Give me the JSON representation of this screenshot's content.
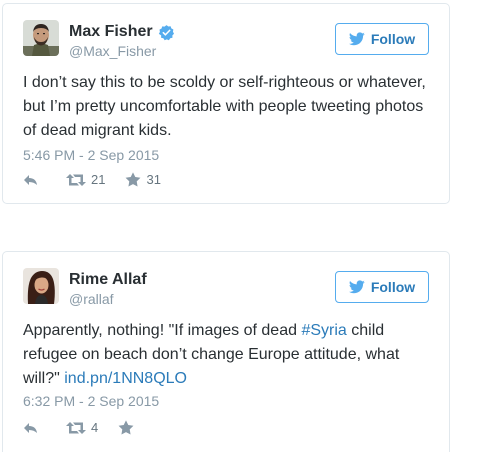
{
  "tweets": [
    {
      "display_name": "Max Fisher",
      "handle": "@Max_Fisher",
      "verified": true,
      "follow_label": "Follow",
      "text": "I don’t say this to be scoldy or self-righteous or whatever, but I’m pretty uncomfortable with people tweeting photos of dead migrant kids.",
      "timestamp": "5:46 PM - 2 Sep 2015",
      "retweets": "21",
      "likes": "31"
    },
    {
      "display_name": "Rime Allaf",
      "handle": "@rallaf",
      "verified": false,
      "follow_label": "Follow",
      "text_pre": "Apparently, nothing! \"If images of dead ",
      "hashtag": "#Syria",
      "text_mid": " child refugee on beach don’t change Europe attitude, what will?\" ",
      "link": "ind.pn/1NN8QLO",
      "timestamp": "6:32 PM - 2 Sep 2015",
      "retweets": "4",
      "likes": ""
    }
  ],
  "colors": {
    "link": "#2b7bb9",
    "border": "#e1e8ed",
    "muted": "#8899a6",
    "follow_border": "#55acee",
    "verified": "#55acee"
  },
  "icons": [
    "verified-badge-icon",
    "twitter-bird-icon",
    "reply-icon",
    "retweet-icon",
    "like-star-icon"
  ]
}
